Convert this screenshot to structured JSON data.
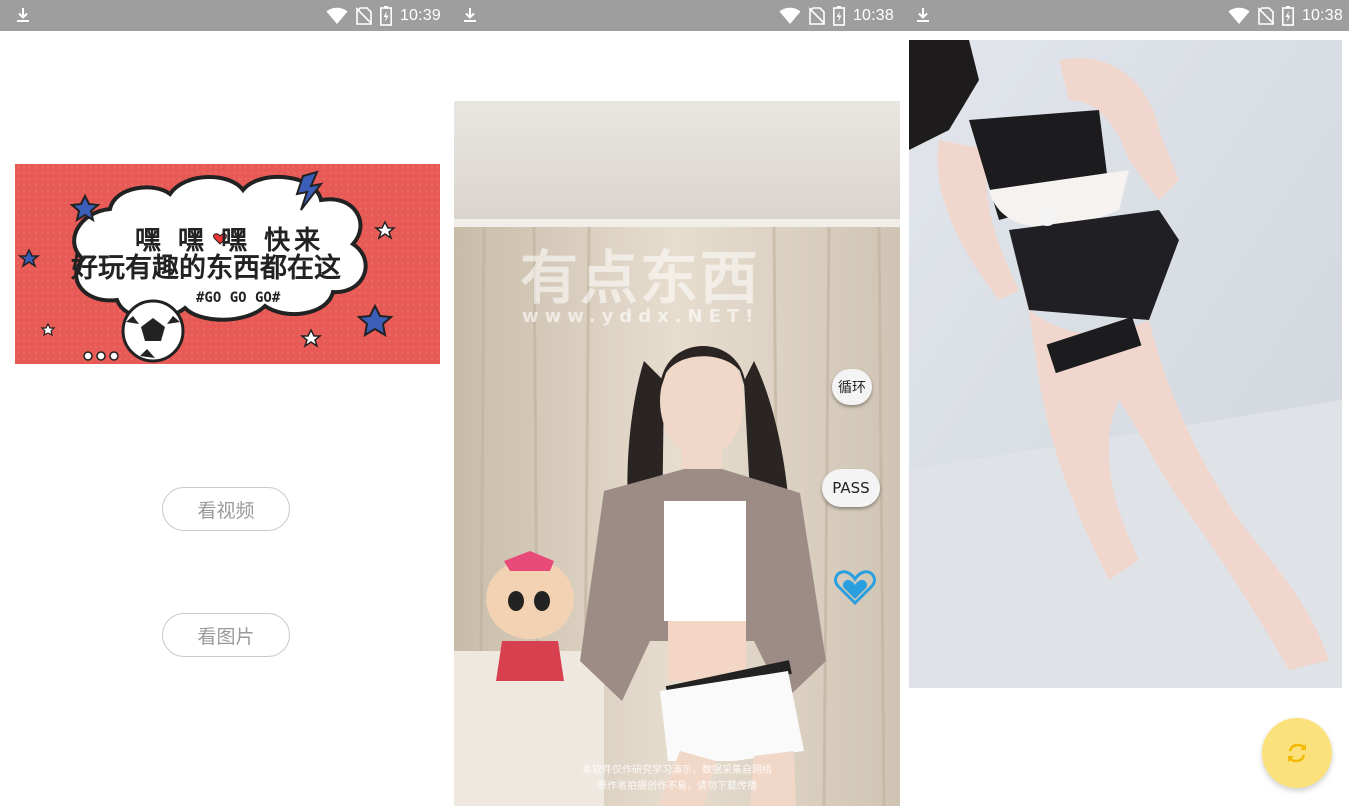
{
  "status_bars": [
    {
      "time": "10:39"
    },
    {
      "time": "10:38"
    },
    {
      "time": "10:38"
    }
  ],
  "home": {
    "banner": {
      "line1": "嘿 嘿 嘿 快来",
      "line2": "好玩有趣的东西都在这",
      "tag": "#GO GO GO#"
    },
    "video_button": "看视频",
    "image_button": "看图片"
  },
  "video": {
    "watermark_title": "有点东西",
    "watermark_url": "www.yddx.NET!",
    "loop_button": "循环",
    "pass_button": "PASS",
    "like_icon": "heart-icon",
    "disclaimer_line1": "本软件仅作研究学习演示，数据采集自网络",
    "disclaimer_line2": "原作者拍摄创作不易，请勿下载传播"
  },
  "gallery": {
    "refresh_icon": "refresh-icon"
  },
  "colors": {
    "status_bar": "#9e9e9e",
    "banner_bg": "#e85a55",
    "fab": "#fbe17b",
    "heart": "#2a9fe0"
  }
}
